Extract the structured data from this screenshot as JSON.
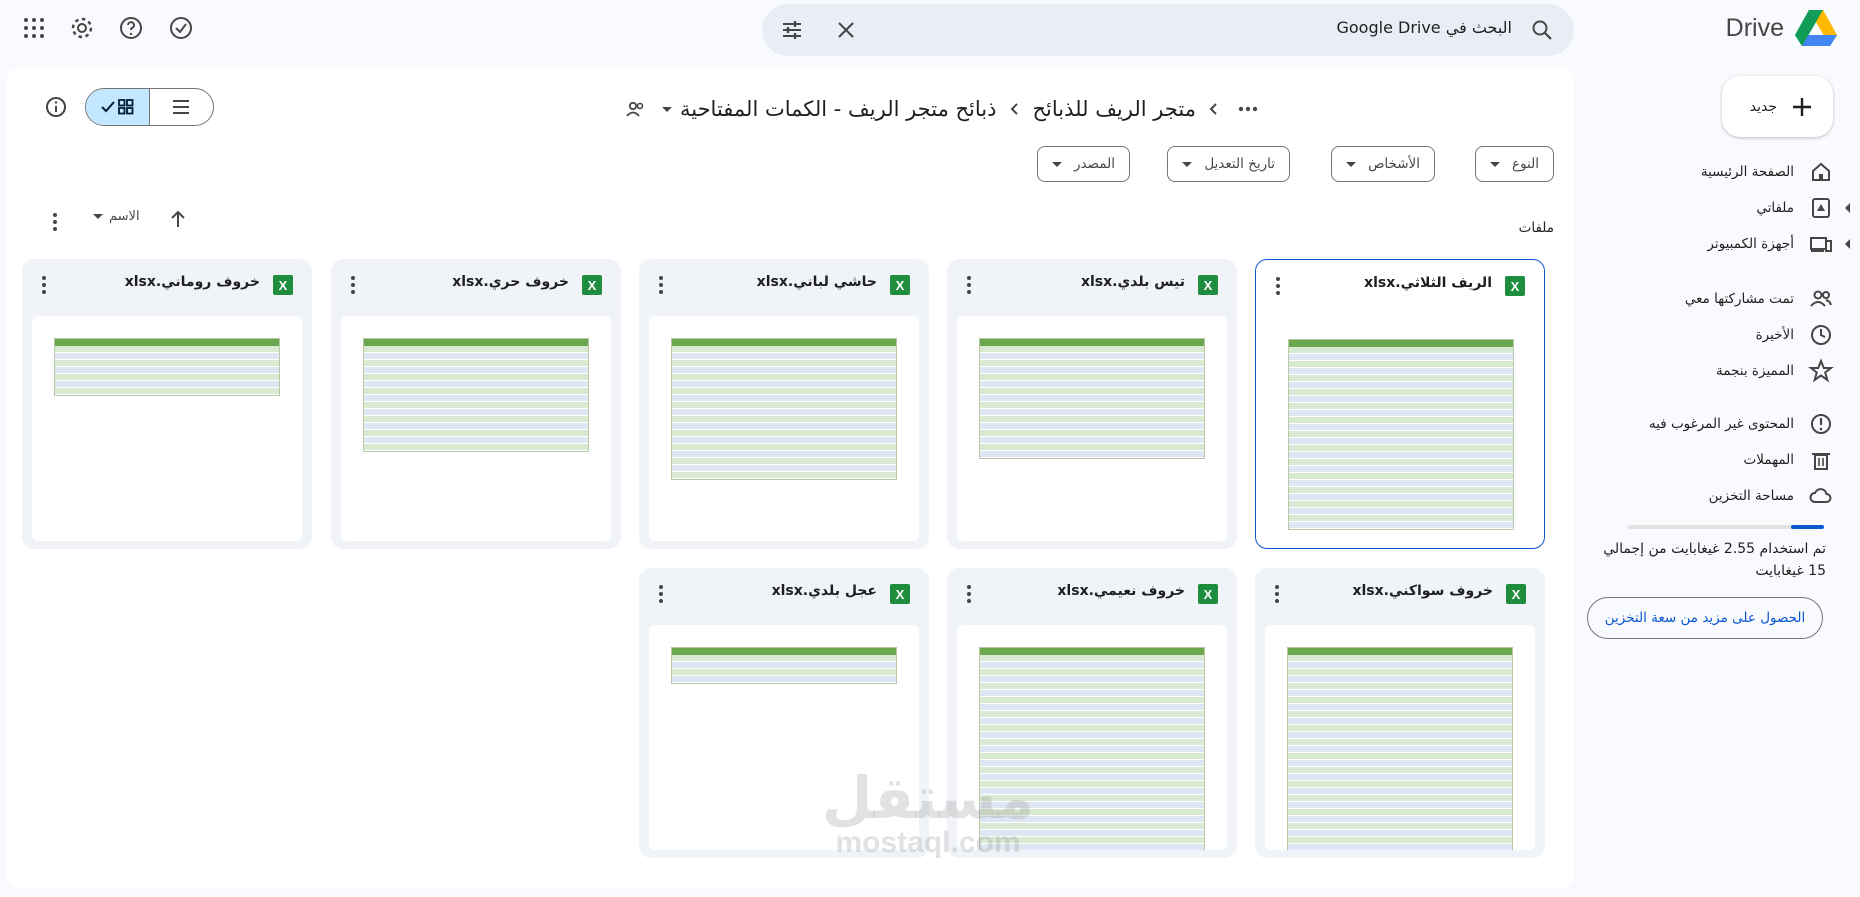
{
  "app": {
    "name": "Drive"
  },
  "search": {
    "placeholder": "البحث في Google Drive"
  },
  "sidebar": {
    "new_label": "جديد",
    "items": [
      {
        "label": "الصفحة الرئيسية",
        "icon": "home-icon"
      },
      {
        "label": "ملفاتي",
        "icon": "my-drive-icon"
      },
      {
        "label": "أجهزة الكمبيوتر",
        "icon": "computers-icon"
      },
      {
        "label": "تمت مشاركتها معي",
        "icon": "shared-icon"
      },
      {
        "label": "الأخيرة",
        "icon": "clock-icon"
      },
      {
        "label": "المميزة بنجمة",
        "icon": "star-icon"
      },
      {
        "label": "المحتوى غير المرغوب فيه",
        "icon": "spam-icon"
      },
      {
        "label": "المهملات",
        "icon": "trash-icon"
      },
      {
        "label": "مساحة التخزين",
        "icon": "cloud-icon"
      }
    ],
    "storage_text": "تم استخدام 2.55 غيغابايت من إجمالي 15 غيغابايت",
    "storage_fraction": 0.17,
    "storage_button": "الحصول على مزيد من سعة التخزين"
  },
  "breadcrumb": {
    "parent": "متجر الريف للذبائح",
    "current": "ذبائح متجر الريف - الكمات المفتاحية"
  },
  "filters": [
    "النوع",
    "الأشخاص",
    "تاريخ التعديل",
    "المصدر"
  ],
  "files_label": "ملفات",
  "sort_label": "الاسم",
  "files": [
    {
      "name": "الريف الثلاثي.xlsx",
      "rows": 26
    },
    {
      "name": "تيس بلدي.xlsx",
      "rows": 16
    },
    {
      "name": "حاشي لباني.xlsx",
      "rows": 19
    },
    {
      "name": "خروف حري.xlsx",
      "rows": 15
    },
    {
      "name": "خروف روماني.xlsx",
      "rows": 7
    },
    {
      "name": "خروف سواكني.xlsx",
      "rows": 28
    },
    {
      "name": "خروف نعيمي.xlsx",
      "rows": 28
    },
    {
      "name": "عجل بلدي.xlsx",
      "rows": 4
    }
  ],
  "watermark": {
    "arabic": "مستقل",
    "latin": "mostaql.com"
  }
}
